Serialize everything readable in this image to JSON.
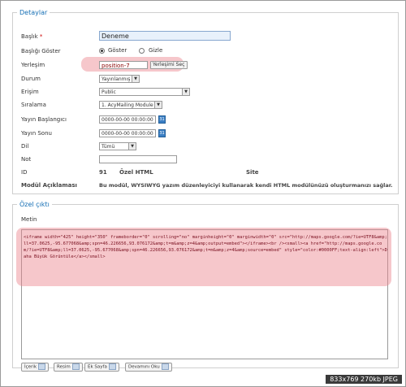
{
  "details": {
    "legend": "Detaylar",
    "title_label": "Başlık",
    "title_required_mark": " *",
    "title_value": "Deneme",
    "show_title_label": "Başlığı Göster",
    "show_option": "Göster",
    "hide_option": "Gizle",
    "position_label": "Yerleşim",
    "position_value": "position-7",
    "position_button": "Yerleşimi Seç",
    "status_label": "Durum",
    "status_value": "Yayınlanmış",
    "access_label": "Erişim",
    "access_value": "Public",
    "ordering_label": "Sıralama",
    "ordering_value": "1. AcyMailing Module",
    "publish_up_label": "Yayın Başlangıcı",
    "publish_up_value": "0000-00-00 00:00:00",
    "publish_down_label": "Yayın Sonu",
    "publish_down_value": "0000-00-00 00:00:00",
    "language_label": "Dil",
    "language_value": "Tümü",
    "note_label": "Not",
    "note_value": "",
    "id_label": "ID",
    "id_value": "91",
    "module_type": "Özel HTML",
    "client": "Site",
    "description_label": "Modül Açıklaması",
    "description_value": "Bu modül, WYSIWYG yazım düzenleyiciyi kullanarak kendi HTML modülünüzü oluşturmanızı sağlar."
  },
  "custom_output": {
    "legend": "Özel çıktı",
    "text_label": "Metin",
    "code": "<iframe width=\"425\" height=\"350\" frameborder=\"0\" scrolling=\"no\" marginheight=\"0\" marginwidth=\"0\" src=\"http://maps.google.com/?ie=UTF8&amp;ll=37.0625,-95.677068&amp;spn=46.226656,93.076172&amp;t=m&amp;z=4&amp;output=embed\"></iframe><br /><small><a href=\"http://maps.google.com/?ie=UTF8&amp;ll=37.0625,-95.677068&amp;spn=46.226656,93.076172&amp;t=m&amp;z=4&amp;source=embed\" style=\"color:#0000FF;text-align:left\">Daha Büyük Görüntüle</a></small>",
    "buttons": [
      "İçerik",
      "Resim",
      "Ek Sayfa",
      "Devamını Oku"
    ]
  },
  "footer": {
    "info": "833x769  270kb  JPEG"
  },
  "icons": {
    "calendar": "calendar-icon",
    "select_arrow": "chevron-down-icon"
  },
  "colors": {
    "legend": "#146eb4",
    "highlight": "#eb828c",
    "code_text": "#7a1020"
  }
}
